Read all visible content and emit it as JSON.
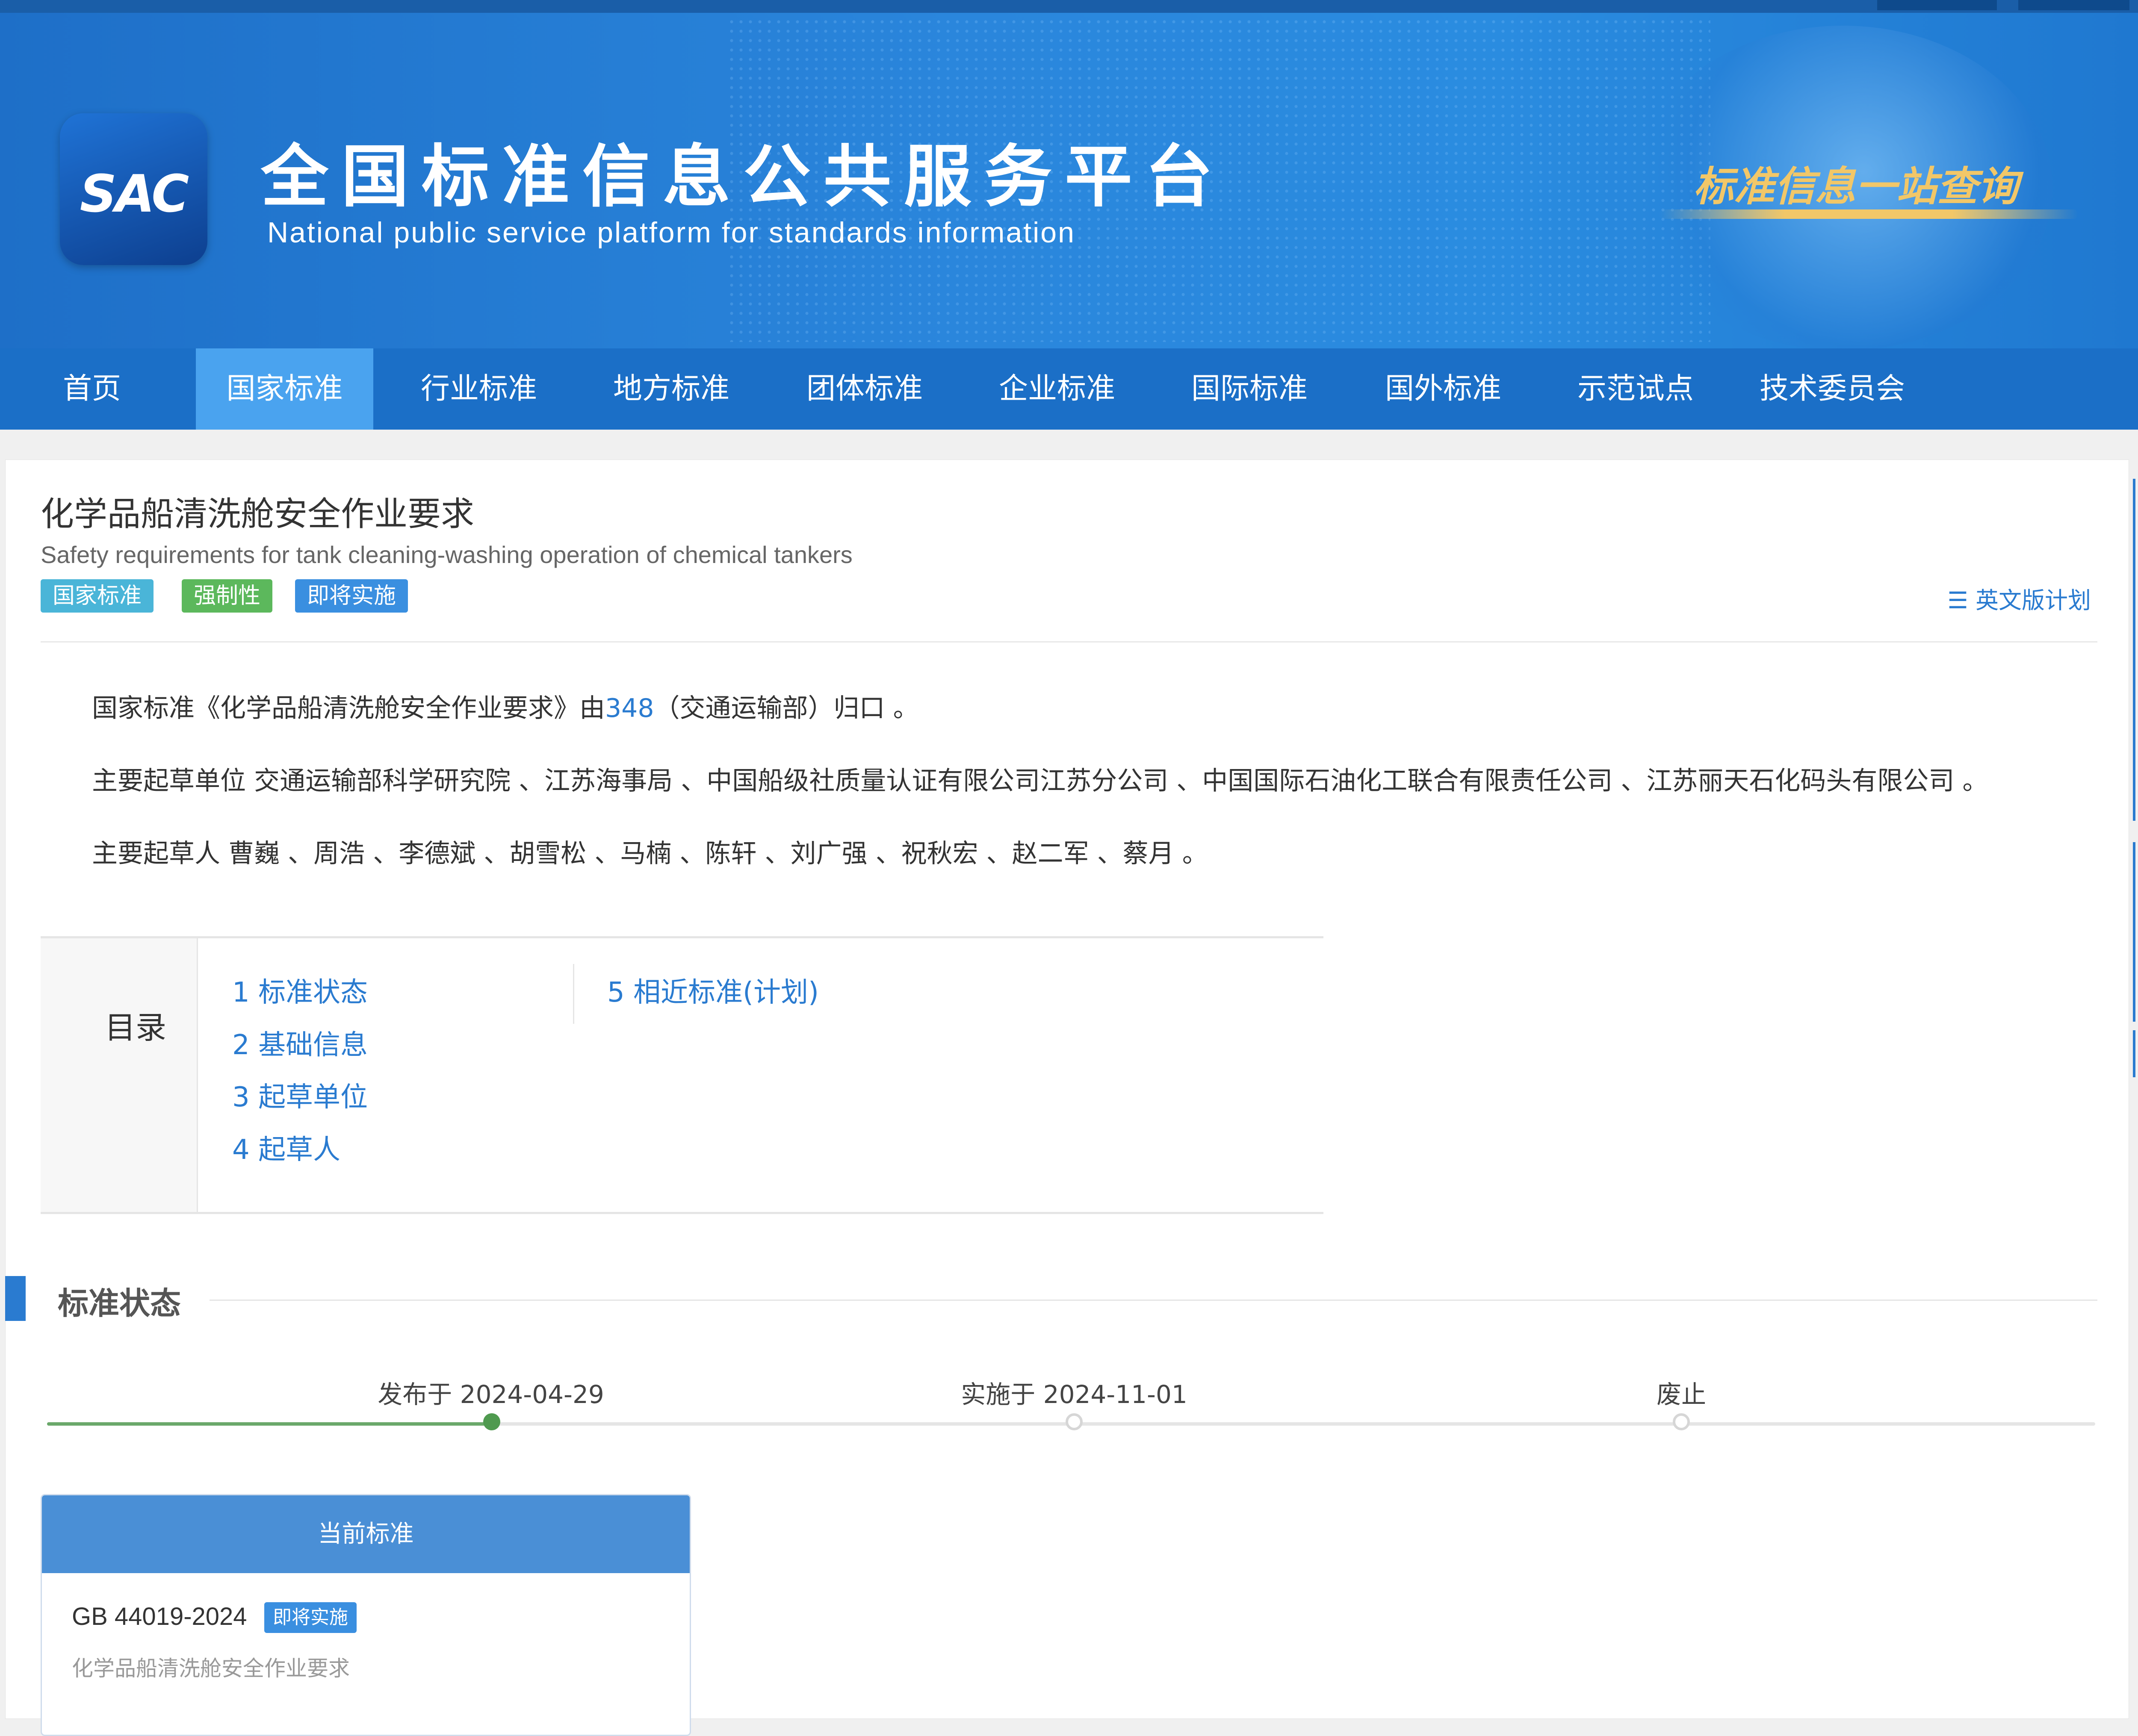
{
  "header": {
    "logo_text": "SAC",
    "title": "全国标准信息公共服务平台",
    "subtitle": "National public service platform  for standards information",
    "slogan": "标准信息一站查询"
  },
  "nav": {
    "items": [
      {
        "label": "首页"
      },
      {
        "label": "国家标准",
        "active": true
      },
      {
        "label": "行业标准"
      },
      {
        "label": "地方标准"
      },
      {
        "label": "团体标准"
      },
      {
        "label": "企业标准"
      },
      {
        "label": "国际标准"
      },
      {
        "label": "国外标准"
      },
      {
        "label": "示范试点"
      },
      {
        "label": "技术委员会"
      }
    ]
  },
  "standard": {
    "title": "化学品船清洗舱安全作业要求",
    "title_en": "Safety requirements for tank cleaning-washing operation of chemical tankers",
    "tags": [
      "国家标准",
      "强制性",
      "即将实施"
    ],
    "tag_colors": [
      "#4ab5d8",
      "#5cb85c",
      "#3a8fe0"
    ],
    "en_plan_label": "英文版计划"
  },
  "description": {
    "line1_prefix": "国家标准《化学品船清洗舱安全作业要求》由",
    "line1_link": "348",
    "line1_suffix": "（交通运输部）归口 。",
    "line2": "主要起草单位 交通运输部科学研究院 、江苏海事局 、中国船级社质量认证有限公司江苏分公司 、中国国际石油化工联合有限责任公司 、江苏丽天石化码头有限公司 。",
    "line3": "主要起草人 曹巍 、周浩 、李德斌 、胡雪松 、马楠 、陈轩 、刘广强 、祝秋宏 、赵二军 、蔡月 。"
  },
  "toc": {
    "label": "目录",
    "items": [
      "1  标准状态",
      "2  基础信息",
      "3  起草单位",
      "4  起草人",
      "5  相近标准(计划)"
    ]
  },
  "status_section": {
    "title": "标准状态",
    "timeline": [
      {
        "label": "发布于 2024-04-29",
        "done": true
      },
      {
        "label": "实施于 2024-11-01",
        "done": false
      },
      {
        "label": "废止",
        "done": false
      }
    ]
  },
  "current_standard": {
    "header": "当前标准",
    "code": "GB 44019-2024",
    "badge": "即将实施",
    "name": "化学品船清洗舱安全作业要求"
  },
  "colors": {
    "brand_blue": "#1b6fc7",
    "nav_active": "#4aa3ef",
    "link": "#2a7bd0",
    "timeline_done": "#4f9a4f"
  }
}
